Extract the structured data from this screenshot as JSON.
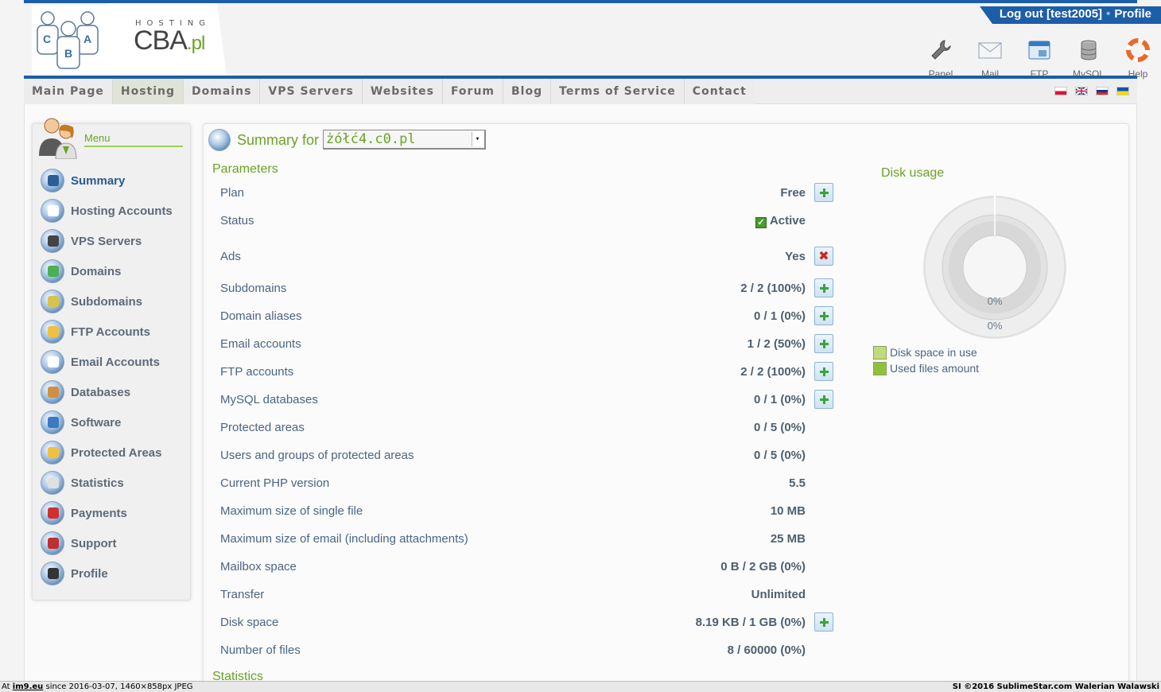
{
  "header": {
    "logo_hosting": "HOSTING",
    "logo_cba": "CBA",
    "logo_pl": ".pl",
    "logout_label": "Log out [test2005]",
    "separator": "•",
    "profile_label": "Profile",
    "tools": [
      {
        "label": "Panel",
        "icon": "wrench-icon"
      },
      {
        "label": "Mail",
        "icon": "envelope-icon"
      },
      {
        "label": "FTP",
        "icon": "ftp-window-icon"
      },
      {
        "label": "MySQL",
        "icon": "database-icon"
      },
      {
        "label": "Help",
        "icon": "lifebuoy-icon"
      }
    ]
  },
  "nav": {
    "items": [
      "Main Page",
      "Hosting",
      "Domains",
      "VPS Servers",
      "Websites",
      "Forum",
      "Blog",
      "Terms of Service",
      "Contact"
    ],
    "flags": [
      "pl-flag-icon",
      "uk-flag-icon",
      "ru-flag-icon",
      "ua-flag-icon"
    ]
  },
  "sidebar": {
    "title": "Menu",
    "items": [
      {
        "label": "Summary",
        "icon": "summary-icon",
        "color": "#2c5f95"
      },
      {
        "label": "Hosting Accounts",
        "icon": "calendar-icon",
        "color": "#ffffff"
      },
      {
        "label": "VPS Servers",
        "icon": "server-icon",
        "color": "#444444"
      },
      {
        "label": "Domains",
        "icon": "globe-icon",
        "color": "#4caf50"
      },
      {
        "label": "Subdomains",
        "icon": "subdomain-globe-icon",
        "color": "#d8c34a"
      },
      {
        "label": "FTP Accounts",
        "icon": "folder-icon",
        "color": "#f0c040"
      },
      {
        "label": "Email Accounts",
        "icon": "envelope-icon",
        "color": "#ffffff"
      },
      {
        "label": "Databases",
        "icon": "database-icon",
        "color": "#d09040"
      },
      {
        "label": "Software",
        "icon": "gear-icon",
        "color": "#3a7ac0"
      },
      {
        "label": "Protected Areas",
        "icon": "lightning-icon",
        "color": "#f0c040"
      },
      {
        "label": "Statistics",
        "icon": "chart-icon",
        "color": "#e0e0e0"
      },
      {
        "label": "Payments",
        "icon": "dollar-icon",
        "color": "#d03030"
      },
      {
        "label": "Support",
        "icon": "support-person-icon",
        "color": "#c03030"
      },
      {
        "label": "Profile",
        "icon": "user-icon",
        "color": "#333333"
      }
    ]
  },
  "main": {
    "summary_for": "Summary for",
    "domain": "żółć4.c0.pl",
    "parameters_title": "Parameters",
    "statistics_title": "Statistics",
    "params": [
      {
        "label": "Plan",
        "value": "Free",
        "button": "plus"
      },
      {
        "label": "Status",
        "value": "Active",
        "button": "",
        "check": true
      },
      {
        "label": "Ads",
        "value": "Yes",
        "button": "remove"
      },
      {
        "label": "Subdomains",
        "value": "2 / 2 (100%)",
        "button": "plus"
      },
      {
        "label": "Domain aliases",
        "value": "0 / 1 (0%)",
        "button": "plus"
      },
      {
        "label": "Email accounts",
        "value": "1 / 2 (50%)",
        "button": "plus"
      },
      {
        "label": "FTP accounts",
        "value": "2 / 2 (100%)",
        "button": "plus"
      },
      {
        "label": "MySQL databases",
        "value": "0 / 1 (0%)",
        "button": "plus"
      },
      {
        "label": "Protected areas",
        "value": "0 / 5 (0%)",
        "button": ""
      },
      {
        "label": "Users and groups of protected areas",
        "value": "0 / 5 (0%)",
        "button": ""
      },
      {
        "label": "Current PHP version",
        "value": "5.5",
        "button": ""
      },
      {
        "label": "Maximum size of single file",
        "value": "10 MB",
        "button": ""
      },
      {
        "label": "Maximum size of email (including attachments)",
        "value": "25 MB",
        "button": ""
      },
      {
        "label": "Mailbox space",
        "value": "0 B / 2 GB (0%)",
        "button": ""
      },
      {
        "label": "Transfer",
        "value": "Unlimited",
        "button": ""
      },
      {
        "label": "Disk space",
        "value": "8.19 KB / 1 GB (0%)",
        "button": "plus"
      },
      {
        "label": "Number of files",
        "value": "8 / 60000 (0%)",
        "button": ""
      }
    ]
  },
  "disk_usage": {
    "title": "Disk usage",
    "inner_label": "0%",
    "outer_label": "0%",
    "legend": [
      {
        "label": "Disk space in use",
        "color": "#bfdc7a"
      },
      {
        "label": "Used files amount",
        "color": "#8fc23a"
      }
    ]
  },
  "footer": {
    "left_prefix": "At",
    "left_link": "im9.eu",
    "left_suffix": "since 2016-03-07, 1460×858px JPEG",
    "right": "SI ©2016 SublimeStar.com Walerian Walawski"
  }
}
